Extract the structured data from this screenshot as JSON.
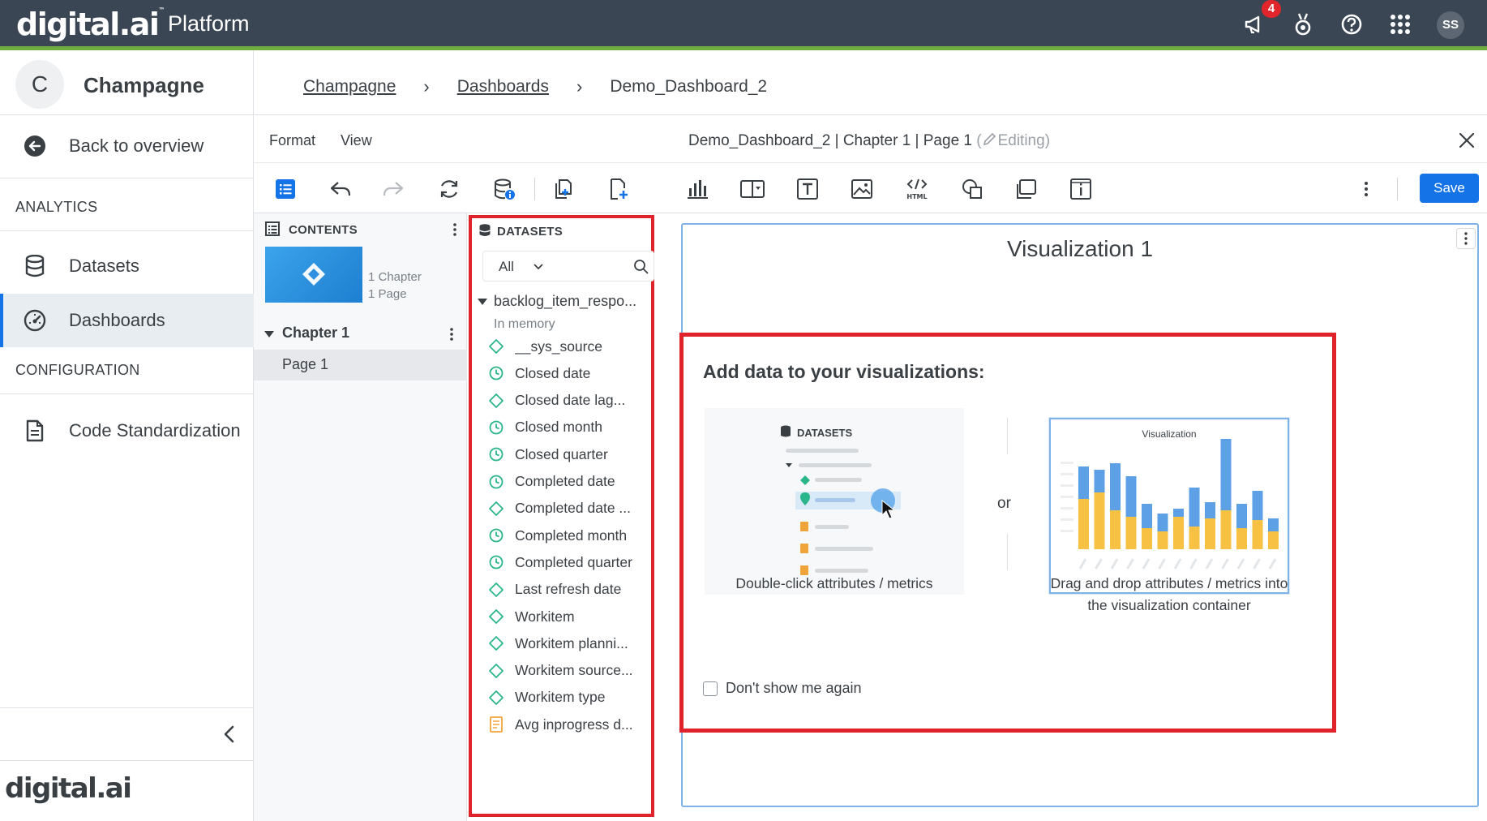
{
  "app": {
    "brand": "digital.ai",
    "brand_mark": "™",
    "product": "Platform",
    "notification_count": "4",
    "user_initials": "SS"
  },
  "workspace": {
    "initial": "C",
    "name": "Champagne"
  },
  "nav": {
    "back": "Back to overview",
    "section_analytics": "ANALYTICS",
    "datasets": "Datasets",
    "dashboards": "Dashboards",
    "section_configuration": "CONFIGURATION",
    "code_standardization": "Code Standardization"
  },
  "breadcrumb": {
    "items": [
      "Champagne",
      "Dashboards"
    ],
    "current": "Demo_Dashboard_2"
  },
  "editor": {
    "menu_format": "Format",
    "menu_view": "View",
    "doc_title": "Demo_Dashboard_2 | Chapter 1 | Page 1",
    "status": "Editing)",
    "status_open": "(",
    "save": "Save"
  },
  "contents": {
    "title": "CONTENTS",
    "chapter_count": "1 Chapter",
    "page_count": "1 Page",
    "chapter": "Chapter 1",
    "page": "Page 1"
  },
  "datasets": {
    "title": "DATASETS",
    "filter": "All",
    "source": "backlog_item_respo...",
    "source_mode": "In memory",
    "fields": [
      {
        "label": "__sys_source",
        "type": "attribute"
      },
      {
        "label": "Closed date",
        "type": "time"
      },
      {
        "label": "Closed date lag...",
        "type": "attribute"
      },
      {
        "label": "Closed month",
        "type": "time"
      },
      {
        "label": "Closed quarter",
        "type": "time"
      },
      {
        "label": "Completed date",
        "type": "time"
      },
      {
        "label": "Completed date ...",
        "type": "attribute"
      },
      {
        "label": "Completed month",
        "type": "time"
      },
      {
        "label": "Completed quarter",
        "type": "time"
      },
      {
        "label": "Last refresh date",
        "type": "attribute"
      },
      {
        "label": "Workitem",
        "type": "attribute"
      },
      {
        "label": "Workitem planni...",
        "type": "attribute"
      },
      {
        "label": "Workitem source...",
        "type": "attribute"
      },
      {
        "label": "Workitem type",
        "type": "attribute"
      },
      {
        "label": "Avg inprogress d...",
        "type": "metric"
      }
    ]
  },
  "visualization": {
    "title": "Visualization 1",
    "popup": {
      "title": "Add data to your visualizations:",
      "illus_datasets_label": "DATASETS",
      "illus_viz_label": "Visualization",
      "or": "or",
      "left_caption": "Double-click attributes / metrics",
      "right_caption_line1": "Drag and drop attributes / metrics into",
      "right_caption_line2": "the visualization container",
      "dont_show": "Don't show me again"
    }
  },
  "colors": {
    "accent": "#1473e6",
    "topbar": "#3b4654",
    "highlight": "#e0232a",
    "attribute": "#2bb58a",
    "metric": "#f0a53a"
  }
}
